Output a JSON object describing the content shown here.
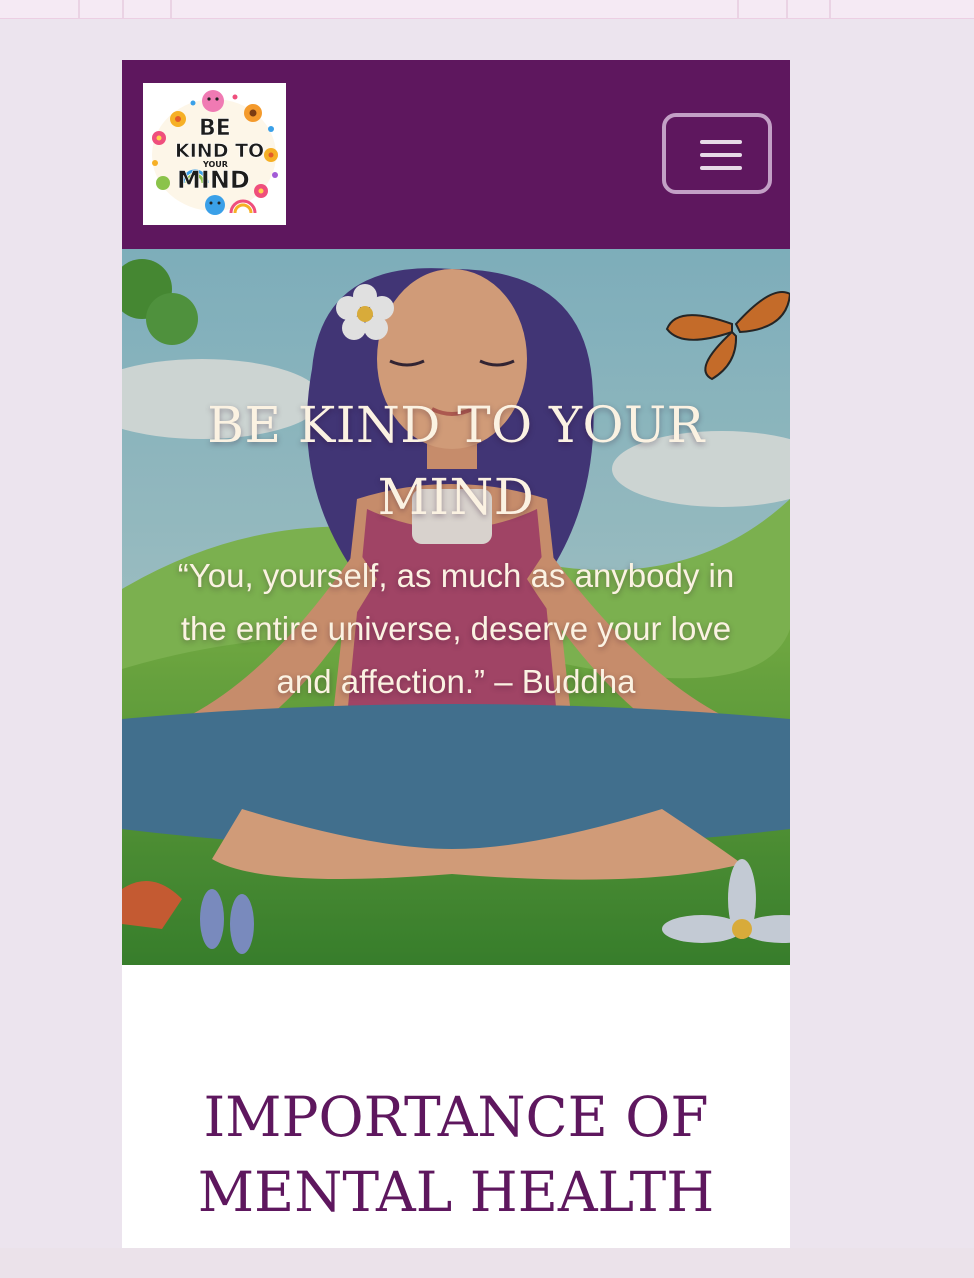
{
  "navbar": {
    "logo_label": "BE KIND TO YOUR MIND",
    "logo_lines": [
      "BE",
      "KIND TO",
      "YOUR",
      "MIND"
    ],
    "menu_toggle": "menu-icon"
  },
  "hero": {
    "title": "BE KIND TO YOUR MIND",
    "quote": "“You, yourself, as much as anybody in the entire universe, deserve your love and affection.” – Buddha"
  },
  "sections": {
    "importance_title": "IMPORTANCE OF MENTAL HEALTH"
  },
  "colors": {
    "brand_purple": "#5e175e",
    "hero_text": "#fbf2e2",
    "page_background": "#ece4ee"
  }
}
